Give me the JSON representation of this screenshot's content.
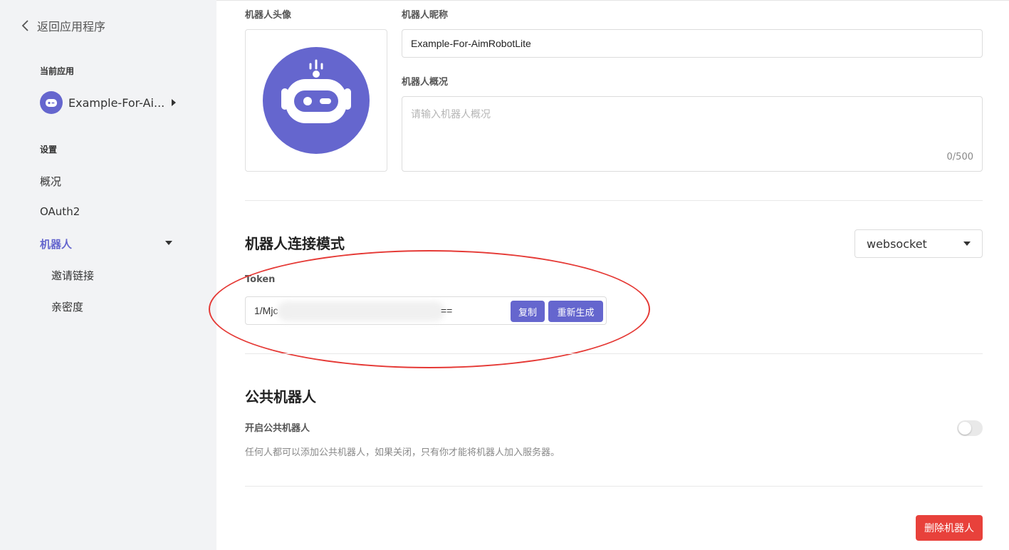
{
  "sidebar": {
    "back_label": "返回应用程序",
    "current_app_label": "当前应用",
    "app_name": "Example-For-Ai...",
    "settings_label": "设置",
    "nav": {
      "overview": "概况",
      "oauth2": "OAuth2",
      "robot": "机器人",
      "invite_link": "邀请链接",
      "intimacy": "亲密度"
    }
  },
  "profile": {
    "avatar_label": "机器人头像",
    "nickname_label": "机器人昵称",
    "nickname_value": "Example-For-AimRobotLite",
    "summary_label": "机器人概况",
    "summary_placeholder": "请输入机器人概况",
    "summary_counter": "0/500"
  },
  "connection": {
    "title": "机器人连接模式",
    "mode_value": "websocket",
    "token_label": "Token",
    "token_prefix": "1/Mjc",
    "token_suffix": "==",
    "copy_button": "复制",
    "regenerate_button": "重新生成"
  },
  "public_robot": {
    "title": "公共机器人",
    "toggle_label": "开启公共机器人",
    "hint": "任何人都可以添加公共机器人，如果关闭，只有你才能将机器人加入服务器。",
    "enabled": false
  },
  "actions": {
    "delete_button": "删除机器人"
  },
  "colors": {
    "accent": "#6566ce",
    "danger": "#e8413b",
    "annotation": "#e53935",
    "sidebar_bg": "#f2f3f5"
  }
}
